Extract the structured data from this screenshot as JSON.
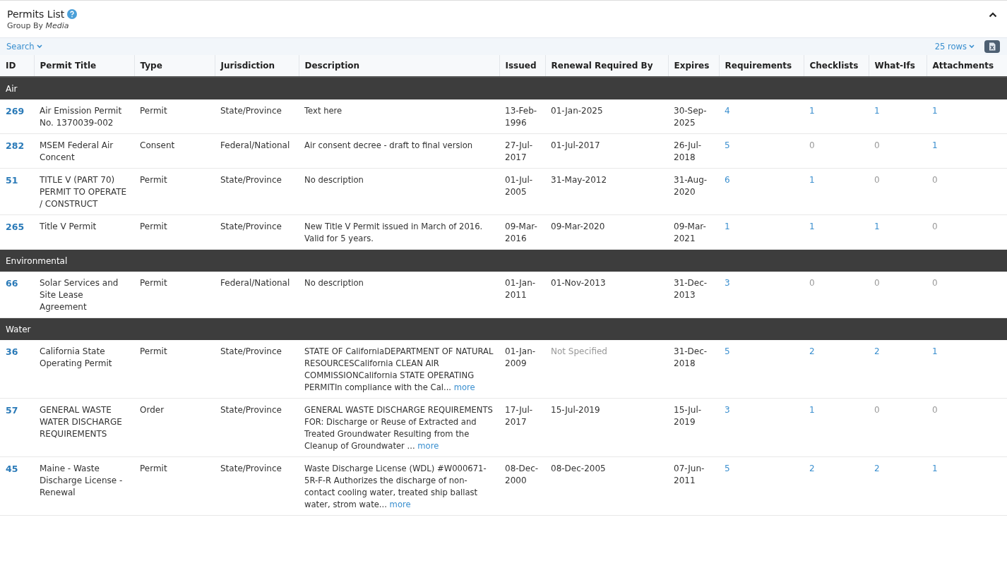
{
  "panel": {
    "title": "Permits List",
    "subtitle_prefix": "Group By",
    "subtitle_value": "Media",
    "collapsed": false
  },
  "toolbar": {
    "search": "Search",
    "rows": "25 rows"
  },
  "table": {
    "columns": [
      "ID",
      "Permit Title",
      "Type",
      "Jurisdiction",
      "Description",
      "Issued",
      "Renewal Required By",
      "Expires",
      "Requirements",
      "Checklists",
      "What-Ifs",
      "Attachments"
    ],
    "groups": [
      {
        "name": "Air",
        "rows": [
          {
            "id": "269",
            "title": "Air Emission Permit No. 1370039-002",
            "type": "Permit",
            "jurisdiction": "State/Province",
            "description": "Text here",
            "more": "",
            "issued": "13-Feb-1996",
            "renewal": "01-Jan-2025",
            "renewal_specified": true,
            "expires": "30-Sep-2025",
            "counts": [
              {
                "text": "4",
                "link": true
              },
              {
                "text": "1",
                "link": true
              },
              {
                "text": "1",
                "link": true
              },
              {
                "text": "1",
                "link": true
              }
            ]
          },
          {
            "id": "282",
            "title": "MSEM Federal Air Concent",
            "type": "Consent",
            "jurisdiction": "Federal/National",
            "description": "Air consent decree - draft to final version",
            "more": "",
            "issued": "27-Jul-2017",
            "renewal": "01-Jul-2017",
            "renewal_specified": true,
            "expires": "26-Jul-2018",
            "counts": [
              {
                "text": "5",
                "link": true
              },
              {
                "text": "0",
                "link": false
              },
              {
                "text": "0",
                "link": false
              },
              {
                "text": "1",
                "link": true
              }
            ]
          },
          {
            "id": "51",
            "title": "TITLE V (PART 70) PERMIT TO OPERATE / CONSTRUCT",
            "type": "Permit",
            "jurisdiction": "State/Province",
            "description": "No description",
            "more": "",
            "issued": "01-Jul-2005",
            "renewal": "31-May-2012",
            "renewal_specified": true,
            "expires": "31-Aug-2020",
            "counts": [
              {
                "text": "6",
                "link": true
              },
              {
                "text": "1",
                "link": true
              },
              {
                "text": "0",
                "link": false
              },
              {
                "text": "0",
                "link": false
              }
            ]
          },
          {
            "id": "265",
            "title": "Title V Permit",
            "type": "Permit",
            "jurisdiction": "State/Province",
            "description": "New Title V Permit issued in March of 2016. Valid for 5 years.",
            "more": "",
            "issued": "09-Mar-2016",
            "renewal": "09-Mar-2020",
            "renewal_specified": true,
            "expires": "09-Mar-2021",
            "counts": [
              {
                "text": "1",
                "link": true
              },
              {
                "text": "1",
                "link": true
              },
              {
                "text": "1",
                "link": true
              },
              {
                "text": "0",
                "link": false
              }
            ]
          }
        ]
      },
      {
        "name": "Environmental",
        "rows": [
          {
            "id": "66",
            "title": "Solar Services and Site Lease Agreement",
            "type": "Permit",
            "jurisdiction": "Federal/National",
            "description": "No description",
            "more": "",
            "issued": "01-Jan-2011",
            "renewal": "01-Nov-2013",
            "renewal_specified": true,
            "expires": "31-Dec-2013",
            "counts": [
              {
                "text": "3",
                "link": true
              },
              {
                "text": "0",
                "link": false
              },
              {
                "text": "0",
                "link": false
              },
              {
                "text": "0",
                "link": false
              }
            ]
          }
        ]
      },
      {
        "name": "Water",
        "rows": [
          {
            "id": "36",
            "title": "California State Operating Permit",
            "type": "Permit",
            "jurisdiction": "State/Province",
            "description": "STATE OF CaliforniaDEPARTMENT OF NATURAL RESOURCESCalifornia CLEAN AIR COMMISSIONCalifornia STATE OPERATING PERMITIn compliance with the Cal...",
            "more": "more",
            "issued": "01-Jan-2009",
            "renewal": "Not Specified",
            "renewal_specified": false,
            "expires": "31-Dec-2018",
            "counts": [
              {
                "text": "5",
                "link": true
              },
              {
                "text": "2",
                "link": true
              },
              {
                "text": "2",
                "link": true
              },
              {
                "text": "1",
                "link": true
              }
            ]
          },
          {
            "id": "57",
            "title": "GENERAL WASTE WATER DISCHARGE REQUIREMENTS",
            "type": "Order",
            "jurisdiction": "State/Province",
            "description": "GENERAL WASTE DISCHARGE REQUIREMENTS FOR: Discharge or Reuse of Extracted and Treated Groundwater Resulting from the Cleanup of Groundwater ...",
            "more": "more",
            "issued": "17-Jul-2017",
            "renewal": "15-Jul-2019",
            "renewal_specified": true,
            "expires": "15-Jul-2019",
            "counts": [
              {
                "text": "3",
                "link": true
              },
              {
                "text": "1",
                "link": true
              },
              {
                "text": "0",
                "link": false
              },
              {
                "text": "0",
                "link": false
              }
            ]
          },
          {
            "id": "45",
            "title": "Maine - Waste Discharge License - Renewal",
            "type": "Permit",
            "jurisdiction": "State/Province",
            "description": "Waste Discharge License (WDL) #W000671-5R-F-R Authorizes the discharge of non-contact cooling water, treated ship ballast water, strom wate...",
            "more": "more",
            "issued": "08-Dec-2000",
            "renewal": "08-Dec-2005",
            "renewal_specified": true,
            "expires": "07-Jun-2011",
            "counts": [
              {
                "text": "5",
                "link": true
              },
              {
                "text": "2",
                "link": true
              },
              {
                "text": "2",
                "link": true
              },
              {
                "text": "1",
                "link": true
              }
            ]
          }
        ]
      }
    ]
  }
}
